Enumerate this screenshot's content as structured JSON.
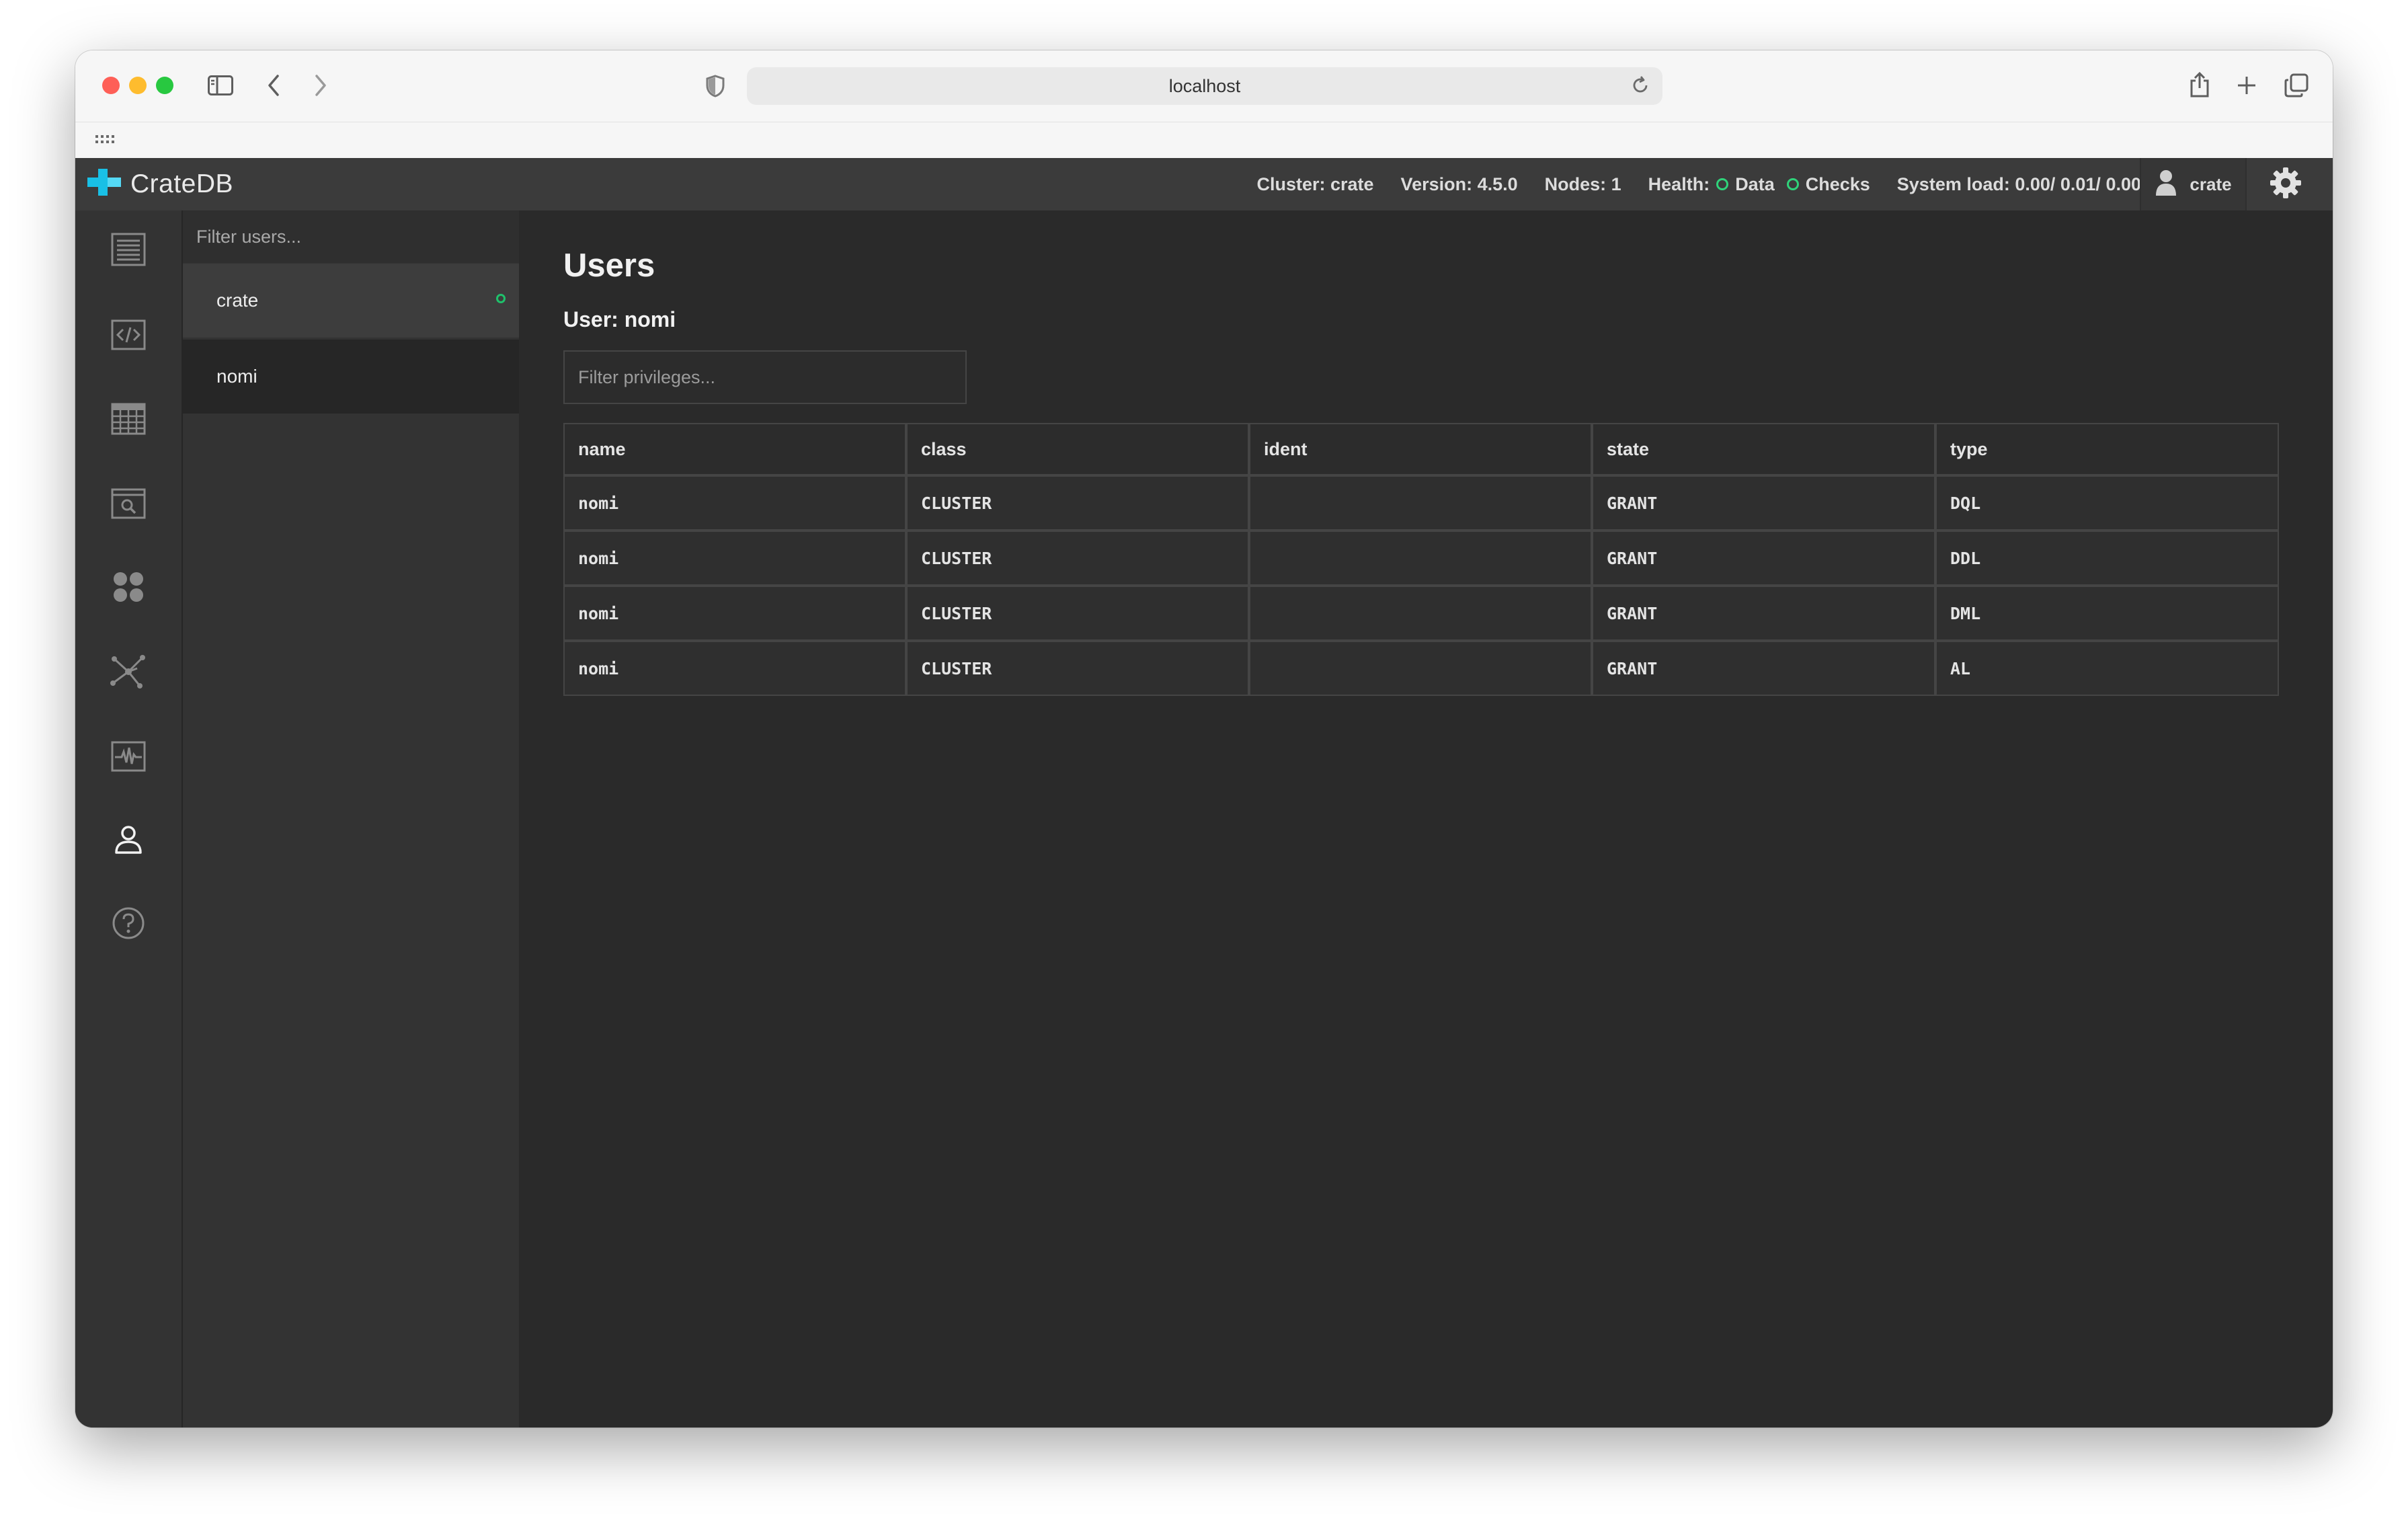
{
  "browser": {
    "url": "localhost"
  },
  "topbar": {
    "app_name": "CrateDB",
    "cluster": "Cluster: crate",
    "version": "Version: 4.5.0",
    "nodes": "Nodes: 1",
    "health_label": "Health:",
    "health_data": "Data",
    "health_checks": "Checks",
    "system_load": "System load: 0.00/ 0.01/ 0.00",
    "user": "crate",
    "health_color": "#2fd37a"
  },
  "sidebar": {
    "items": [
      {
        "name": "overview-icon"
      },
      {
        "name": "console-icon"
      },
      {
        "name": "tables-icon"
      },
      {
        "name": "views-icon"
      },
      {
        "name": "cluster-icon"
      },
      {
        "name": "shards-icon"
      },
      {
        "name": "monitoring-icon"
      },
      {
        "name": "users-icon",
        "active": true
      },
      {
        "name": "help-icon"
      }
    ]
  },
  "userlist": {
    "filter_placeholder": "Filter users...",
    "users": [
      {
        "name": "crate",
        "online": true
      },
      {
        "name": "nomi",
        "online": false
      }
    ]
  },
  "main": {
    "title": "Users",
    "user_heading": "User: nomi",
    "filter_placeholder": "Filter privileges...",
    "columns": [
      "name",
      "class",
      "ident",
      "state",
      "type"
    ],
    "rows": [
      [
        "nomi",
        "CLUSTER",
        "",
        "GRANT",
        "DQL"
      ],
      [
        "nomi",
        "CLUSTER",
        "",
        "GRANT",
        "DDL"
      ],
      [
        "nomi",
        "CLUSTER",
        "",
        "GRANT",
        "DML"
      ],
      [
        "nomi",
        "CLUSTER",
        "",
        "GRANT",
        "AL"
      ]
    ]
  }
}
